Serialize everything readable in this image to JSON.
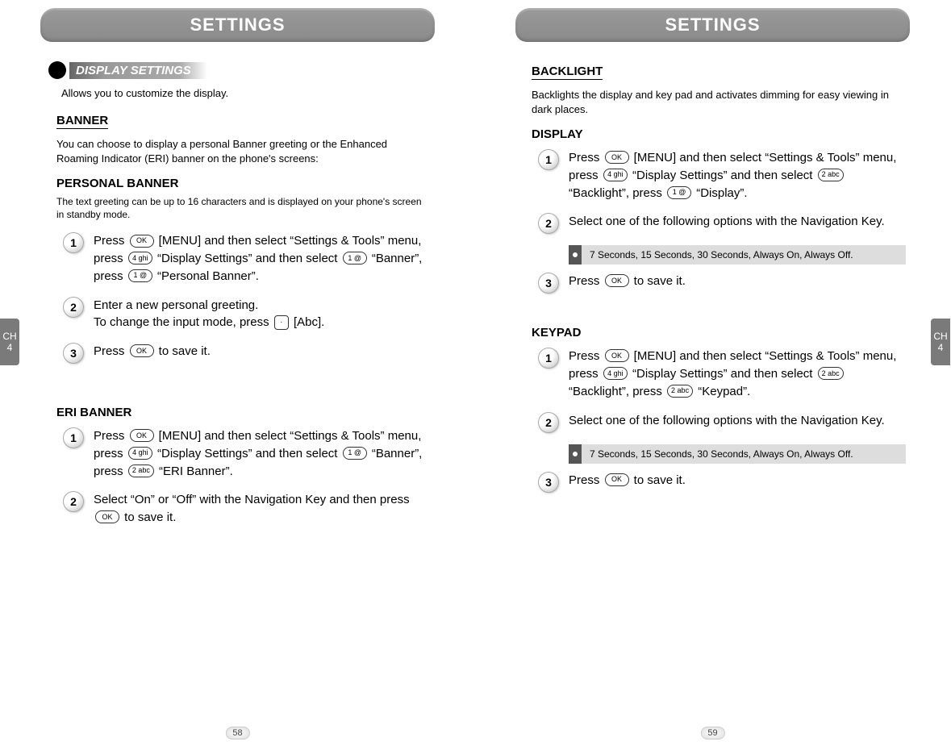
{
  "left": {
    "header": "SETTINGS",
    "section_tag": "DISPLAY SETTINGS",
    "intro": "Allows you to customize the display.",
    "banner": {
      "title": "BANNER",
      "desc": "You can choose to display a personal Banner greeting or the Enhanced Roaming Indicator (ERI) banner on the phone's screens:"
    },
    "personal_banner": {
      "title": "PERSONAL BANNER",
      "desc": "The text greeting can be up to 16 characters and is displayed on your phone's screen in standby mode.",
      "steps": [
        {
          "n": "1",
          "parts": [
            "Press ",
            {
              "key": "OK"
            },
            " [MENU] and then select “Settings & Tools” menu, press ",
            {
              "key": "4 ghi"
            },
            " “Display Settings” and then select ",
            {
              "key": "1 @"
            },
            " “Banner”, press ",
            {
              "key": "1 @"
            },
            " “Personal Banner”."
          ]
        },
        {
          "n": "2",
          "parts": [
            "Enter a new personal greeting.\nTo change the input mode, press ",
            {
              "keysq": "·"
            },
            " [Abc]."
          ]
        },
        {
          "n": "3",
          "parts": [
            "Press ",
            {
              "key": "OK"
            },
            " to save it."
          ]
        }
      ]
    },
    "eri_banner": {
      "title": "ERI BANNER",
      "steps": [
        {
          "n": "1",
          "parts": [
            "Press ",
            {
              "key": "OK"
            },
            " [MENU] and then select “Settings & Tools” menu, press ",
            {
              "key": "4 ghi"
            },
            " “Display Settings” and then select ",
            {
              "key": "1 @"
            },
            " “Banner”, press ",
            {
              "key": "2 abc"
            },
            " “ERI Banner”."
          ]
        },
        {
          "n": "2",
          "parts": [
            "Select “On” or “Off” with the Navigation Key and then press ",
            {
              "key": "OK"
            },
            " to save it."
          ]
        }
      ]
    },
    "ch_label_top": "CH",
    "ch_label_num": "4",
    "page_number": "58"
  },
  "right": {
    "header": "SETTINGS",
    "backlight": {
      "title": "BACKLIGHT",
      "desc": "Backlights the display and key pad and activates dimming for easy viewing in dark places."
    },
    "display": {
      "title": "DISPLAY",
      "steps": [
        {
          "n": "1",
          "parts": [
            "Press ",
            {
              "key": "OK"
            },
            " [MENU] and then select “Settings & Tools” menu, press ",
            {
              "key": "4 ghi"
            },
            " “Display Settings” and then select ",
            {
              "key": "2 abc"
            },
            " “Backlight”, press ",
            {
              "key": "1 @"
            },
            " “Display”."
          ]
        },
        {
          "n": "2",
          "parts": [
            "Select one of the following options with the Navigation Key."
          ]
        },
        {
          "n": "3",
          "parts": [
            "Press ",
            {
              "key": "OK"
            },
            " to save it."
          ]
        }
      ],
      "note": "7 Seconds, 15 Seconds, 30 Seconds, Always On, Always Off."
    },
    "keypad": {
      "title": "KEYPAD",
      "steps": [
        {
          "n": "1",
          "parts": [
            "Press ",
            {
              "key": "OK"
            },
            " [MENU] and then select “Settings & Tools” menu, press ",
            {
              "key": "4 ghi"
            },
            " “Display Settings” and then select ",
            {
              "key": "2 abc"
            },
            " “Backlight”, press ",
            {
              "key": "2 abc"
            },
            " “Keypad”."
          ]
        },
        {
          "n": "2",
          "parts": [
            "Select one of the following options with the Navigation Key."
          ]
        },
        {
          "n": "3",
          "parts": [
            "Press ",
            {
              "key": "OK"
            },
            " to save it."
          ]
        }
      ],
      "note": "7 Seconds, 15 Seconds, 30 Seconds, Always On, Always Off."
    },
    "ch_label_top": "CH",
    "ch_label_num": "4",
    "page_number": "59"
  }
}
